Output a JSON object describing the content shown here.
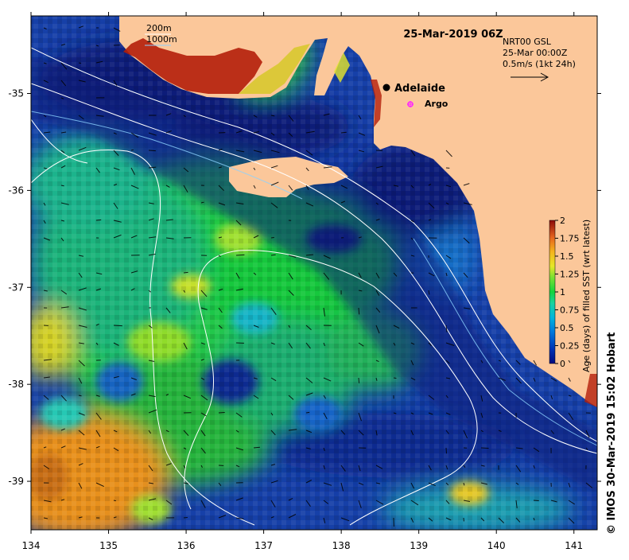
{
  "map": {
    "title": "25-Mar-2019 06Z",
    "product": {
      "line1": "NRT00 GSL",
      "line2": "25-Mar 00:00Z",
      "line3": "0.5m/s (1kt 24h)"
    },
    "bathy_legend": [
      "200m",
      "1000m"
    ],
    "places": [
      {
        "name": "Adelaide",
        "lon": 138.6,
        "lat": -34.93,
        "marker": "black-dot"
      },
      {
        "name": "Argo",
        "lon": 138.88,
        "lat": -35.12,
        "marker": "magenta-star"
      }
    ],
    "x_ticks": [
      "134",
      "135",
      "136",
      "137",
      "138",
      "139",
      "140",
      "141"
    ],
    "y_ticks": [
      "-35",
      "-36",
      "-37",
      "-38",
      "-39"
    ],
    "lon_range": [
      134,
      141.3
    ],
    "lat_range": [
      -39.5,
      -34.2
    ],
    "colorbar": {
      "title": "Age (days) of filled SST (wrt latest)",
      "ticks": [
        "2",
        "1.75",
        "1.5",
        "1.25",
        "1",
        "0.75",
        "0.5",
        "0.25",
        "0"
      ],
      "range": [
        0,
        2
      ],
      "colors": [
        "#000a80",
        "#0050d0",
        "#00b4dc",
        "#18d2b0",
        "#14d43c",
        "#a0e632",
        "#f0e628",
        "#f59a1e",
        "#c01e0a",
        "#8c0a0a"
      ]
    },
    "credit": "© IMOS 30-Mar-2019 15:02 Hobart",
    "colors": {
      "land": "#fbc79a",
      "deep_ocean": "#0a1a78",
      "contour": "#ffffff",
      "vector": "#000000",
      "argo": "#ff22ff"
    }
  }
}
